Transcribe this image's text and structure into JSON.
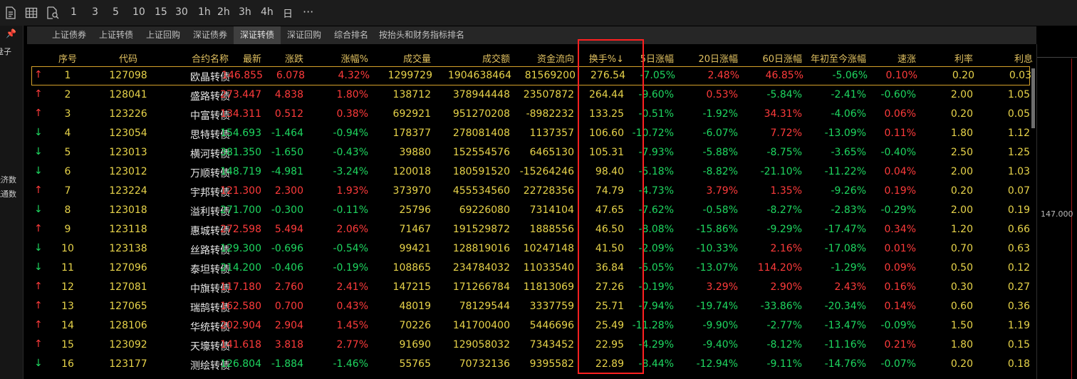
{
  "toolbar": {
    "icons": [
      "document-icon",
      "table-icon",
      "search-document-icon"
    ],
    "periods": [
      "1",
      "3",
      "5",
      "10",
      "15",
      "30",
      "1h",
      "2h",
      "3h",
      "4h",
      "日"
    ],
    "more": "···"
  },
  "left_panel": {
    "labels": [
      "盘子",
      "经济数",
      "流通数"
    ]
  },
  "tabs": [
    "上证债券",
    "上证转债",
    "上证回购",
    "深证债券",
    "深证转债",
    "深证回购",
    "综合排名",
    "按抬头和财务指标排名"
  ],
  "active_tab": "深证转债",
  "columns": [
    "序号",
    "代码",
    "合约名称",
    "最新",
    "涨跌",
    "涨幅%",
    "成交量",
    "成交额",
    "资金流向",
    "换手%↓",
    "5日涨幅",
    "20日涨幅",
    "60日涨幅",
    "年初至今涨幅",
    "速涨",
    "利率",
    "利息"
  ],
  "rows": [
    {
      "dir": "up",
      "no": "1",
      "code": "127098",
      "name": "欧晶转债",
      "last": "146.855",
      "chg": "6.078",
      "pct": "4.32%",
      "vol": "1299729",
      "amt": "1904638464",
      "flow": "81569200",
      "turn": "276.54",
      "d5": "-7.05%",
      "d20": "2.48%",
      "d60": "46.85%",
      "ytd": "-5.06%",
      "speed": "0.10%",
      "rate": "0.20",
      "interest": "0.03"
    },
    {
      "dir": "up",
      "no": "2",
      "code": "128041",
      "name": "盛路转债",
      "last": "273.447",
      "chg": "4.838",
      "pct": "1.80%",
      "vol": "138712",
      "amt": "378944448",
      "flow": "23507872",
      "turn": "264.44",
      "d5": "-9.60%",
      "d20": "0.53%",
      "d60": "-5.84%",
      "ytd": "-2.41%",
      "speed": "-0.60%",
      "rate": "2.00",
      "interest": "1.05"
    },
    {
      "dir": "up",
      "no": "3",
      "code": "123226",
      "name": "中富转债",
      "last": "134.311",
      "chg": "0.512",
      "pct": "0.38%",
      "vol": "692921",
      "amt": "951270208",
      "flow": "-8982232",
      "turn": "133.25",
      "d5": "-0.51%",
      "d20": "-1.92%",
      "d60": "34.31%",
      "ytd": "-4.06%",
      "speed": "0.06%",
      "rate": "0.20",
      "interest": "0.05"
    },
    {
      "dir": "down",
      "no": "4",
      "code": "123054",
      "name": "思特转债",
      "last": "154.693",
      "chg": "-1.464",
      "pct": "-0.94%",
      "vol": "178377",
      "amt": "278081408",
      "flow": "1137357",
      "turn": "106.60",
      "d5": "-10.72%",
      "d20": "-6.07%",
      "d60": "7.72%",
      "ytd": "-13.09%",
      "speed": "0.11%",
      "rate": "1.80",
      "interest": "1.12"
    },
    {
      "dir": "down",
      "no": "5",
      "code": "123013",
      "name": "横河转债",
      "last": "381.350",
      "chg": "-1.650",
      "pct": "-0.43%",
      "vol": "39880",
      "amt": "152554576",
      "flow": "6465130",
      "turn": "105.31",
      "d5": "-7.93%",
      "d20": "-5.88%",
      "d60": "-8.75%",
      "ytd": "-3.65%",
      "speed": "-0.40%",
      "rate": "2.50",
      "interest": "1.25"
    },
    {
      "dir": "down",
      "no": "6",
      "code": "123012",
      "name": "万顺转债",
      "last": "148.719",
      "chg": "-4.981",
      "pct": "-3.24%",
      "vol": "120018",
      "amt": "180591520",
      "flow": "-15264246",
      "turn": "98.40",
      "d5": "-5.18%",
      "d20": "-8.82%",
      "d60": "-21.10%",
      "ytd": "-11.22%",
      "speed": "0.04%",
      "rate": "2.00",
      "interest": "1.03"
    },
    {
      "dir": "up",
      "no": "7",
      "code": "123224",
      "name": "宇邦转债",
      "last": "121.300",
      "chg": "2.300",
      "pct": "1.93%",
      "vol": "373970",
      "amt": "455534560",
      "flow": "22728356",
      "turn": "74.79",
      "d5": "-4.73%",
      "d20": "3.79%",
      "d60": "1.35%",
      "ytd": "-9.26%",
      "speed": "0.19%",
      "rate": "0.20",
      "interest": "0.07"
    },
    {
      "dir": "down",
      "no": "8",
      "code": "123018",
      "name": "溢利转债",
      "last": "271.700",
      "chg": "-0.300",
      "pct": "-0.11%",
      "vol": "25796",
      "amt": "69226080",
      "flow": "7314104",
      "turn": "47.65",
      "d5": "-7.62%",
      "d20": "-0.58%",
      "d60": "-8.27%",
      "ytd": "-2.83%",
      "speed": "-0.29%",
      "rate": "2.00",
      "interest": "0.19"
    },
    {
      "dir": "up",
      "no": "9",
      "code": "123118",
      "name": "惠城转债",
      "last": "272.598",
      "chg": "5.494",
      "pct": "2.06%",
      "vol": "71467",
      "amt": "191529872",
      "flow": "1888556",
      "turn": "46.50",
      "d5": "-8.08%",
      "d20": "-15.86%",
      "d60": "-9.29%",
      "ytd": "-17.47%",
      "speed": "0.34%",
      "rate": "1.20",
      "interest": "0.66"
    },
    {
      "dir": "down",
      "no": "10",
      "code": "123138",
      "name": "丝路转债",
      "last": "129.300",
      "chg": "-0.696",
      "pct": "-0.54%",
      "vol": "99421",
      "amt": "128819016",
      "flow": "10247148",
      "turn": "41.50",
      "d5": "-2.09%",
      "d20": "-10.33%",
      "d60": "2.16%",
      "ytd": "-17.08%",
      "speed": "0.01%",
      "rate": "0.70",
      "interest": "0.63"
    },
    {
      "dir": "down",
      "no": "11",
      "code": "127096",
      "name": "泰坦转债",
      "last": "214.200",
      "chg": "-0.406",
      "pct": "-0.19%",
      "vol": "108865",
      "amt": "234784032",
      "flow": "11033540",
      "turn": "36.84",
      "d5": "-5.05%",
      "d20": "-13.07%",
      "d60": "114.20%",
      "ytd": "-1.29%",
      "speed": "0.09%",
      "rate": "0.50",
      "interest": "0.12"
    },
    {
      "dir": "up",
      "no": "12",
      "code": "127081",
      "name": "中旗转债",
      "last": "117.180",
      "chg": "2.760",
      "pct": "2.41%",
      "vol": "147215",
      "amt": "171266784",
      "flow": "11813069",
      "turn": "27.26",
      "d5": "-0.19%",
      "d20": "3.29%",
      "d60": "2.90%",
      "ytd": "2.43%",
      "speed": "0.16%",
      "rate": "0.30",
      "interest": "0.27"
    },
    {
      "dir": "up",
      "no": "13",
      "code": "127065",
      "name": "瑞鹄转债",
      "last": "162.580",
      "chg": "0.700",
      "pct": "0.43%",
      "vol": "48019",
      "amt": "78129544",
      "flow": "3337759",
      "turn": "25.71",
      "d5": "-7.94%",
      "d20": "-19.74%",
      "d60": "-33.86%",
      "ytd": "-20.34%",
      "speed": "0.14%",
      "rate": "0.60",
      "interest": "0.36"
    },
    {
      "dir": "up",
      "no": "14",
      "code": "128106",
      "name": "华统转债",
      "last": "202.904",
      "chg": "2.904",
      "pct": "1.45%",
      "vol": "70226",
      "amt": "141700400",
      "flow": "5446696",
      "turn": "25.49",
      "d5": "-11.28%",
      "d20": "-9.90%",
      "d60": "-2.77%",
      "ytd": "-13.47%",
      "speed": "-0.09%",
      "rate": "1.50",
      "interest": "1.19"
    },
    {
      "dir": "up",
      "no": "15",
      "code": "123092",
      "name": "天壕转债",
      "last": "141.618",
      "chg": "3.818",
      "pct": "2.77%",
      "vol": "91690",
      "amt": "129058032",
      "flow": "7343452",
      "turn": "22.95",
      "d5": "-4.29%",
      "d20": "-9.40%",
      "d60": "-8.12%",
      "ytd": "-11.16%",
      "speed": "0.21%",
      "rate": "1.80",
      "interest": "0.15"
    },
    {
      "dir": "down",
      "no": "16",
      "code": "123177",
      "name": "测绘转债",
      "last": "126.804",
      "chg": "-1.884",
      "pct": "-1.46%",
      "vol": "55765",
      "amt": "70732136",
      "flow": "9395582",
      "turn": "22.89",
      "d5": "-8.44%",
      "d20": "-12.94%",
      "d60": "-9.11%",
      "ytd": "-14.76%",
      "speed": "-0.07%",
      "rate": "0.20",
      "interest": "0.18"
    }
  ],
  "right_panel": {
    "price_label": "147.000"
  },
  "colors": {
    "up": "#ff3b3b",
    "down": "#1ed760",
    "header": "#e0c060",
    "neutral": "#e8d44a",
    "highlight_box": "#ff2020",
    "selected_row": "#d4a12a"
  }
}
